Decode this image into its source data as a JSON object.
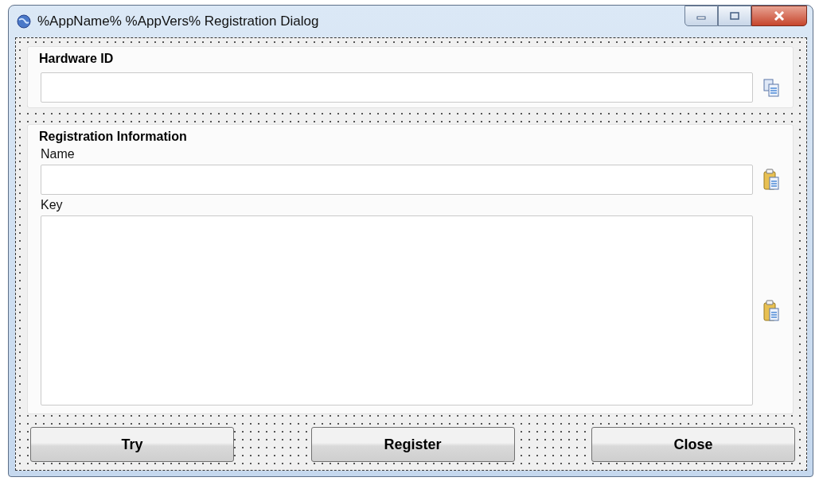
{
  "window": {
    "title": "%AppName% %AppVers% Registration Dialog"
  },
  "hardware": {
    "title": "Hardware ID"
  },
  "registration": {
    "title": "Registration Information",
    "name_label": "Name",
    "key_label": "Key"
  },
  "buttons": [
    "Try",
    "Register",
    "Close"
  ]
}
